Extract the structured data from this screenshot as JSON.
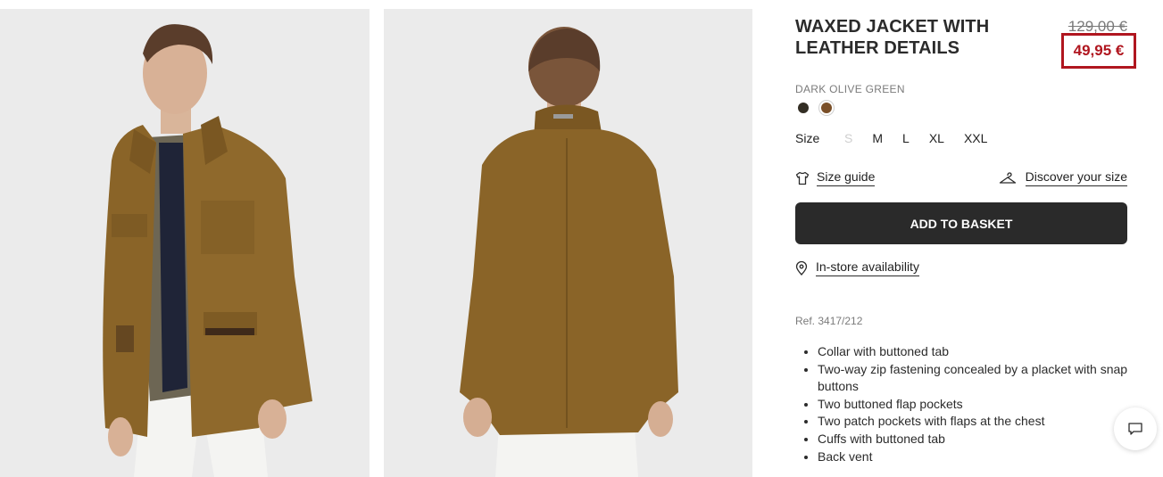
{
  "product": {
    "title": "WAXED JACKET WITH LEATHER DETAILS",
    "old_price": "129,00 €",
    "new_price": "49,95 €",
    "color_name": "DARK OLIVE GREEN",
    "swatches": [
      {
        "name": "dark olive green",
        "color": "#332e24"
      },
      {
        "name": "tan brown",
        "color": "#7a4f28"
      }
    ],
    "size_label": "Size",
    "sizes": [
      "S",
      "M",
      "L",
      "XL",
      "XXL"
    ],
    "size_guide": "Size guide",
    "discover_size": "Discover your size",
    "add_to_basket": "ADD TO BASKET",
    "in_store": "In-store availability",
    "ref": "Ref. 3417/212",
    "features": [
      "Collar with buttoned tab",
      "Two-way zip fastening concealed by a placket with snap buttons",
      "Two buttoned flap pockets",
      "Two patch pockets with flaps at the chest",
      "Cuffs with buttoned tab",
      "Back vent"
    ]
  },
  "colors": {
    "accent": "#b0161f",
    "button": "#2a2a2a",
    "jacket": "#8a6428"
  },
  "icons": {
    "size_guide": "tshirt-icon",
    "discover": "hanger-icon",
    "store": "location-pin-icon",
    "chat": "chat-icon"
  }
}
